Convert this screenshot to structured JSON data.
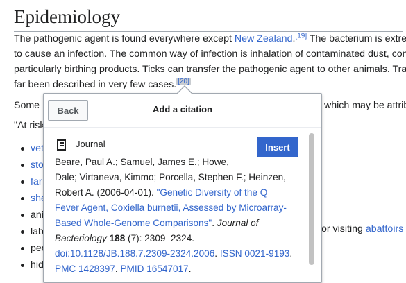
{
  "article": {
    "heading": "Epidemiology",
    "para": {
      "l1_text": "The pathogenic agent is found everywhere except ",
      "l1_link": "New Zealand",
      "l1_ref": "[19]",
      "l1_rest": " The bacterium is extrem",
      "l2": "to cause an infection. The common way of infection is inhalation of contaminated dust, conta",
      "l3": "particularly birthing products. Ticks can transfer the pathogenic agent to other animals. Tran",
      "l4_text": "far been described in very few cases.",
      "l4_ref": "[20]"
    },
    "some_text": "Some",
    "some_right": "which may be attrib",
    "at_risk": "\"At risk",
    "bullets": [
      {
        "text": "vet",
        "link": true
      },
      {
        "text": "sto",
        "link": true
      },
      {
        "text": "far",
        "link": true
      },
      {
        "text": "she",
        "link": true
      },
      {
        "text": "ani",
        "link": false
      },
      {
        "text": "lab",
        "link": false
      },
      {
        "text": "peo",
        "link": false
      },
      {
        "text": "hid",
        "link": false
      }
    ],
    "lab_right_text": "or visiting ",
    "lab_right_link": "abattoirs"
  },
  "popup": {
    "back_label": "Back",
    "title": "Add a citation",
    "type_label": "Journal",
    "type_icon": "document-icon",
    "insert_label": "Insert",
    "citation": {
      "l1": "Beare, Paul A.; Samuel, James E.; Howe,",
      "l2": "Dale; Virtaneva, Kimmo; Porcella, Stephen F.; Heinzen,",
      "l3_text": "Robert A. (2006-04-01). ",
      "l3_link": "\"Genetic Diversity of the Q",
      "l4_link": "Fever Agent, Coxiella burnetii, Assessed by Microarray-",
      "l5_link": "Based Whole-Genome Comparisons\"",
      "l5_text": ". ",
      "l5_italic": "Journal of",
      "l6_italic": "Bacteriology",
      "l6_space": " ",
      "l6_bold": "188",
      "l6_text": " (7): 2309–2324.",
      "l7_link": "doi:10.1128/JB.188.7.2309-2324.2006",
      "l7_text": ". ",
      "l7_link2": "ISSN 0021-9193",
      "l7_end": ".",
      "l8_link": "PMC 1428397",
      "l8_text": ". ",
      "l8_link2": "PMID 16547017",
      "l8_end": "."
    }
  },
  "colors": {
    "link": "#3366cc",
    "primary_button": "#3366cc",
    "text": "#202122",
    "border": "#a2a9b1"
  }
}
